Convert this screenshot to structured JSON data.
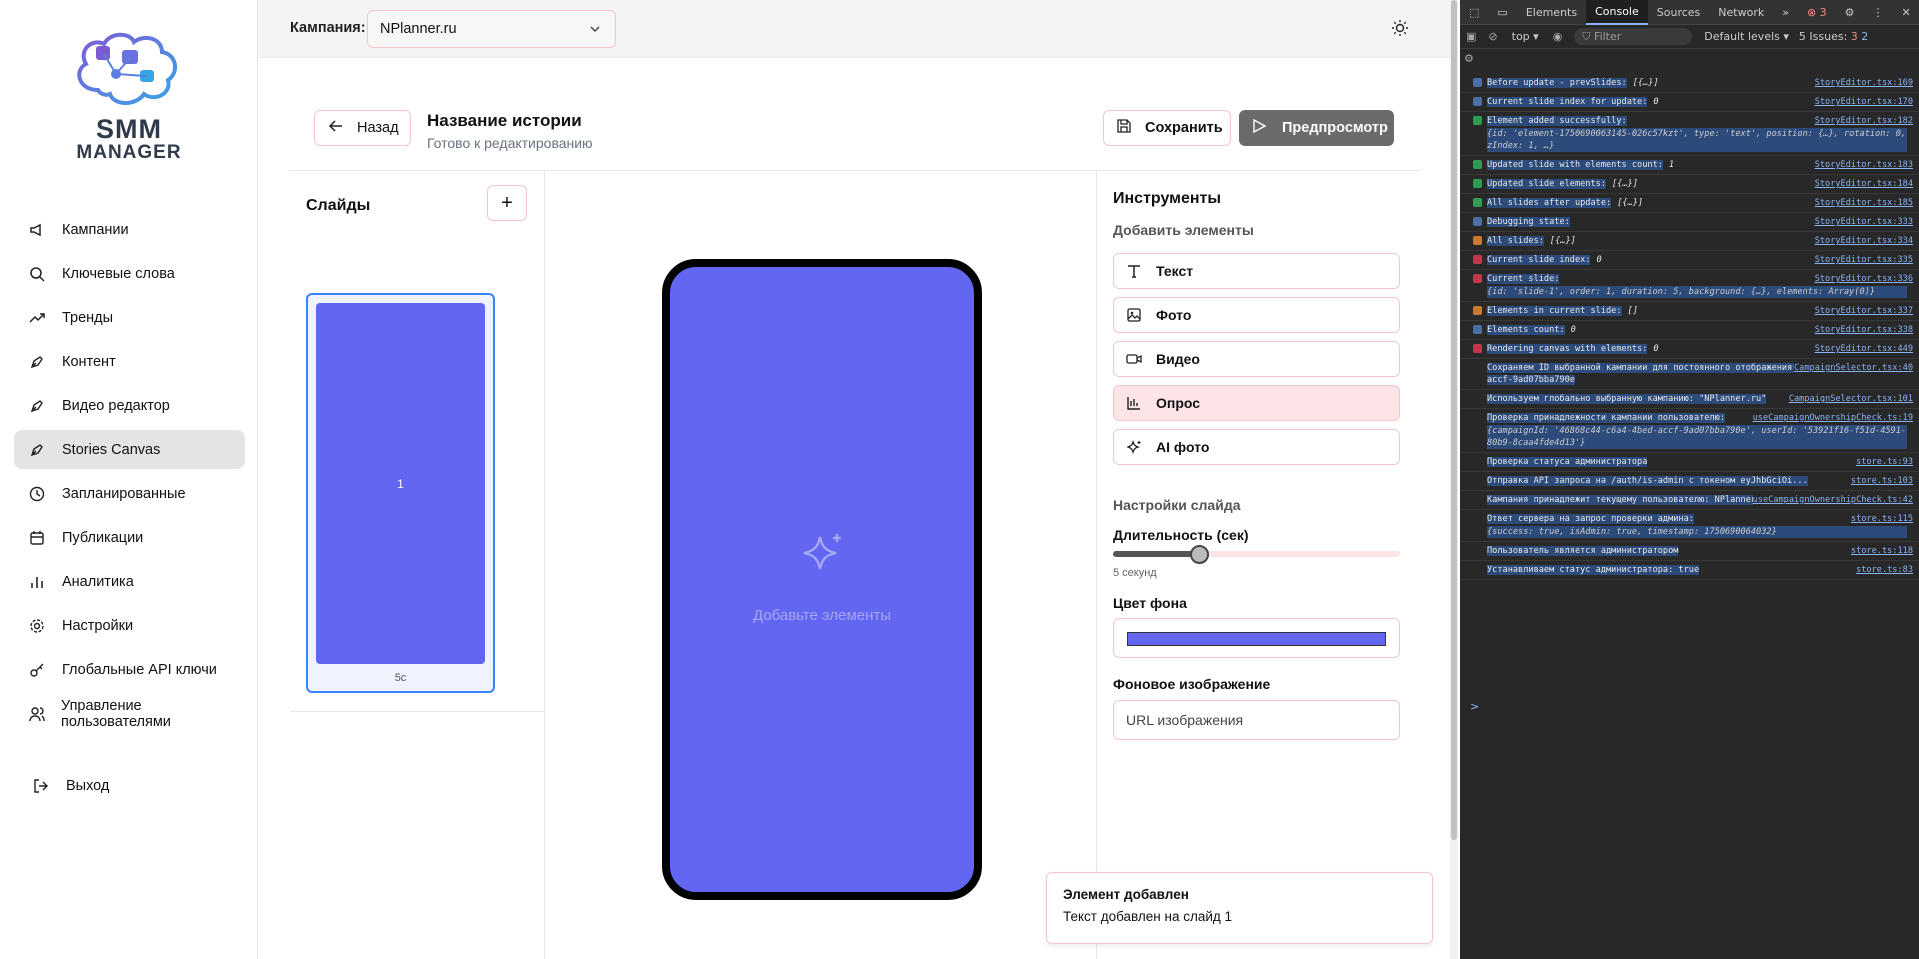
{
  "sidebar": {
    "logo": {
      "line1": "SMM",
      "line2": "MANAGER"
    },
    "items": [
      {
        "label": "Кампании",
        "icon": "megaphone-icon"
      },
      {
        "label": "Ключевые слова",
        "icon": "search-icon"
      },
      {
        "label": "Тренды",
        "icon": "trending-up-icon"
      },
      {
        "label": "Контент",
        "icon": "pen-tool-icon"
      },
      {
        "label": "Видео редактор",
        "icon": "pen-tool-icon"
      },
      {
        "label": "Stories Canvas",
        "icon": "pen-tool-icon",
        "active": true
      },
      {
        "label": "Запланированные",
        "icon": "clock-icon"
      },
      {
        "label": "Публикации",
        "icon": "calendar-icon"
      },
      {
        "label": "Аналитика",
        "icon": "bar-chart-icon"
      },
      {
        "label": "Настройки",
        "icon": "gear-icon"
      },
      {
        "label": "Глобальные API ключи",
        "icon": "key-icon"
      },
      {
        "label": "Управление пользователями",
        "icon": "users-icon"
      }
    ],
    "logout": "Выход"
  },
  "topbar": {
    "campaign_label": "Кампания:",
    "campaign_value": "NPlanner.ru"
  },
  "editor": {
    "back_label": "Назад",
    "title": "Название истории",
    "subtitle": "Готово к редактированию",
    "save_label": "Сохранить",
    "preview_label": "Предпросмотр"
  },
  "slides": {
    "title": "Слайды",
    "add_label": "+",
    "items": [
      {
        "number": "1",
        "duration": "5с",
        "color": "#6366f1"
      }
    ]
  },
  "canvas": {
    "hint": "Добавьте элементы",
    "background": "#6366f1"
  },
  "tools": {
    "title": "Инструменты",
    "add_elements_title": "Добавить элементы",
    "items": [
      {
        "label": "Текст",
        "icon": "type-icon"
      },
      {
        "label": "Фото",
        "icon": "image-icon"
      },
      {
        "label": "Видео",
        "icon": "video-icon"
      },
      {
        "label": "Опрос",
        "icon": "poll-chart-icon",
        "highlighted": true
      },
      {
        "label": "AI фото",
        "icon": "sparkles-icon"
      }
    ],
    "slide_settings_title": "Настройки слайда",
    "duration_label": "Длительность (сек)",
    "duration_value": "5 секунд",
    "duration_fraction": 0.3,
    "bg_color_label": "Цвет фона",
    "bg_color": "#6366f1",
    "bg_image_label": "Фоновое изображение",
    "bg_image_placeholder": "URL изображения"
  },
  "toast": {
    "title": "Элемент добавлен",
    "description": "Текст добавлен на слайд 1"
  },
  "devtools": {
    "tabs": [
      "Elements",
      "Console",
      "Sources",
      "Network"
    ],
    "active_tab": "Console",
    "error_count": "3",
    "context": "top",
    "filter_placeholder": "Filter",
    "levels": "Default levels",
    "issues": "5 Issues:",
    "issues_err": "3",
    "issues_info": "2",
    "logs": [
      {
        "emoji": "#4a6fa5",
        "msg": "Before update - prevSlides:",
        "obj_inline": "[{…}]",
        "src": "StoryEditor.tsx:169"
      },
      {
        "emoji": "#4a6fa5",
        "msg": "Current slide index for update:",
        "obj_inline": "0",
        "src": "StoryEditor.tsx:170"
      },
      {
        "emoji": "#2e9c52",
        "msg": "Element added successfully:",
        "obj": "{id: 'element-1750690063145-026c57kzt', type: 'text', position: {…}, rotation: 0, zIndex: 1, …}",
        "src": "StoryEditor.tsx:182"
      },
      {
        "emoji": "#2e9c52",
        "msg": "Updated slide with elements count:",
        "obj_inline": "1",
        "src": "StoryEditor.tsx:183"
      },
      {
        "emoji": "#2e9c52",
        "msg": "Updated slide elements:",
        "obj_inline": "[{…}]",
        "src": "StoryEditor.tsx:184"
      },
      {
        "emoji": "#2e9c52",
        "msg": "All slides after update:",
        "obj_inline": "[{…}]",
        "src": "StoryEditor.tsx:185"
      },
      {
        "emoji": "#4a6fa5",
        "msg": "Debugging state:",
        "obj_inline": "",
        "src": "StoryEditor.tsx:333"
      },
      {
        "emoji": "#c97a2e",
        "msg": "All slides:",
        "obj_inline": "[{…}]",
        "src": "StoryEditor.tsx:334"
      },
      {
        "emoji": "#c0394b",
        "msg": "Current slide index:",
        "obj_inline": "0",
        "src": "StoryEditor.tsx:335"
      },
      {
        "emoji": "#c0394b",
        "msg": "Current slide:",
        "obj": "{id: 'slide-1', order: 1, duration: 5, background: {…}, elements: Array(0)}",
        "src": "StoryEditor.tsx:336"
      },
      {
        "emoji": "#c97a2e",
        "msg": "Elements in current slide:",
        "obj_inline": "[]",
        "src": "StoryEditor.tsx:337"
      },
      {
        "emoji": "#4a6fa5",
        "msg": "Elements count:",
        "obj_inline": "0",
        "src": "StoryEditor.tsx:338"
      },
      {
        "emoji": "#c0394b",
        "msg": "Rendering canvas with elements:",
        "obj_inline": "0",
        "src": "StoryEditor.tsx:449"
      },
      {
        "emoji": "",
        "msg": "Сохраняем ID выбранной кампании для постоянного отображения: 46868c44-c6a4-4bed-accf-9ad07bba790e",
        "src": "CampaignSelector.tsx:40"
      },
      {
        "emoji": "",
        "msg": "Используем глобально выбранную кампанию: \"NPlanner.ru\"",
        "src": "CampaignSelector.tsx:101"
      },
      {
        "emoji": "",
        "msg": "Проверка принадлежности кампании пользователю:",
        "obj": "{campaignId: '46868c44-c6a4-4bed-accf-9ad07bba790e', userId: '53921f16-f51d-4591-80b9-8caa4fde4d13'}",
        "src": "useCampaignOwnershipCheck.ts:19"
      },
      {
        "emoji": "",
        "msg": "Проверка статуса администратора",
        "src": "store.ts:93"
      },
      {
        "emoji": "",
        "msg": "Отправка API запроса на /auth/is-admin с токеном eyJhbGciOi...",
        "src": "store.ts:103"
      },
      {
        "emoji": "",
        "msg": "Кампания принадлежит текущему пользователю: NPlanner.ru",
        "src": "useCampaignOwnershipCheck.ts:42"
      },
      {
        "emoji": "",
        "msg": "Ответ сервера на запрос проверки админа:",
        "obj": "{success: true, isAdmin: true, timestamp: 1750690064032}",
        "src": "store.ts:115"
      },
      {
        "emoji": "",
        "msg": "Пользователь является администратором",
        "src": "store.ts:118"
      },
      {
        "emoji": "",
        "msg": "Устанавливаем статус администратора: true",
        "src": "store.ts:83"
      }
    ],
    "prompt": ">"
  }
}
